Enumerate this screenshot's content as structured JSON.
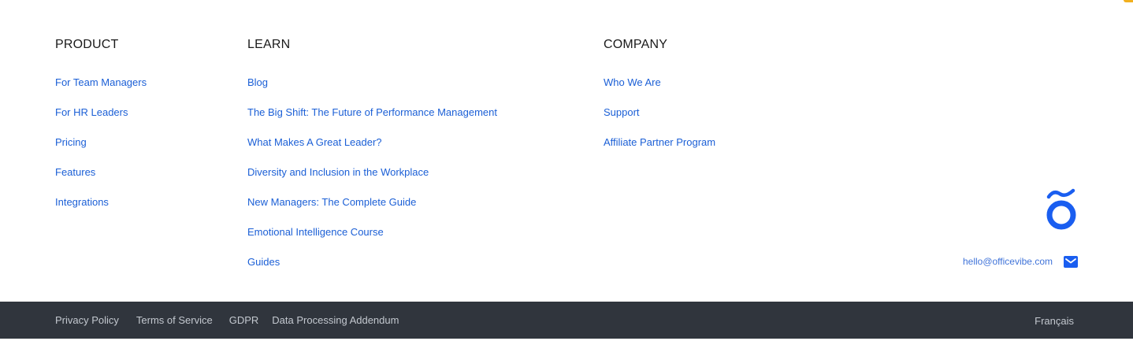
{
  "columns": {
    "product": {
      "heading": "PRODUCT",
      "links": [
        "For Team Managers",
        "For HR Leaders",
        "Pricing",
        "Features",
        "Integrations"
      ]
    },
    "learn": {
      "heading": "LEARN",
      "links": [
        "Blog",
        "The Big Shift: The Future of Performance Management",
        "What Makes A Great Leader?",
        "Diversity and Inclusion in the Workplace",
        "New Managers: The Complete Guide",
        "Emotional Intelligence Course",
        "Guides"
      ]
    },
    "company": {
      "heading": "COMPANY",
      "links": [
        "Who We Are",
        "Support",
        "Affiliate Partner Program"
      ]
    }
  },
  "brand": {
    "logo_icon": "officevibe-o-tilde-logo",
    "color": "#1a5ef0"
  },
  "contact": {
    "email": "hello@officevibe.com",
    "email_icon": "mail-icon"
  },
  "legal": {
    "links": [
      "Privacy Policy",
      "Terms of Service",
      "GDPR",
      "Data Processing Addendum"
    ],
    "language": "Français"
  },
  "colors": {
    "link": "#1b5fd6",
    "bottom_bar": "#30353d",
    "bottom_text": "#c3c8cf",
    "accent": "#f2b01e"
  }
}
